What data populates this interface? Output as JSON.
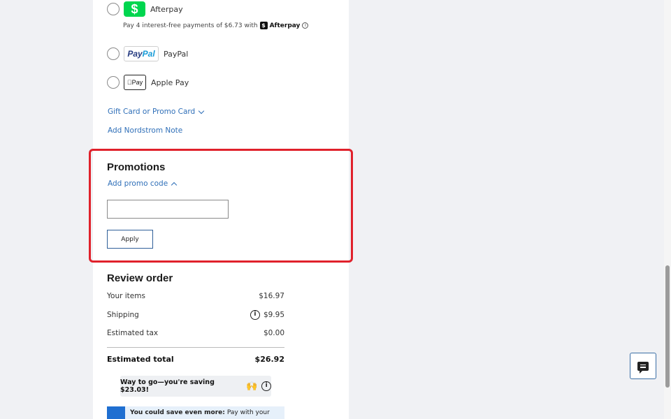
{
  "payment": {
    "afterpay": {
      "label": "Afterpay",
      "logo_glyph": "$",
      "note": "Pay 4 interest-free payments of $6.73 with",
      "brand": "Afterpay"
    },
    "paypal": {
      "label": "PayPal",
      "logo_a": "Pay",
      "logo_b": "Pal"
    },
    "applepay": {
      "label": "Apple Pay",
      "logo": "Pay"
    }
  },
  "links": {
    "gift_card": "Gift Card or Promo Card",
    "nordstrom_note": "Add Nordstrom Note"
  },
  "promotions": {
    "title": "Promotions",
    "add_code": "Add promo code",
    "input_value": "",
    "apply_label": "Apply"
  },
  "review": {
    "title": "Review order",
    "items_label": "Your items",
    "items_value": "$16.97",
    "shipping_label": "Shipping",
    "shipping_value": "$9.95",
    "tax_label": "Estimated tax",
    "tax_value": "$0.00",
    "total_label": "Estimated total",
    "total_value": "$26.92",
    "saving_message": "Way to go—you're saving $23.03!",
    "saving_emoji": "🙌",
    "banner_bold": "You could save even more:",
    "banner_text": "Pay with your"
  },
  "colors": {
    "afterpay_green": "#00d64f",
    "link_blue": "#2f6fb8",
    "highlight_red": "#e0212b"
  },
  "icons": {
    "afterpay": "afterpay-icon",
    "info": "info-icon",
    "chat": "chat-icon",
    "chevron": "chevron-icon"
  }
}
